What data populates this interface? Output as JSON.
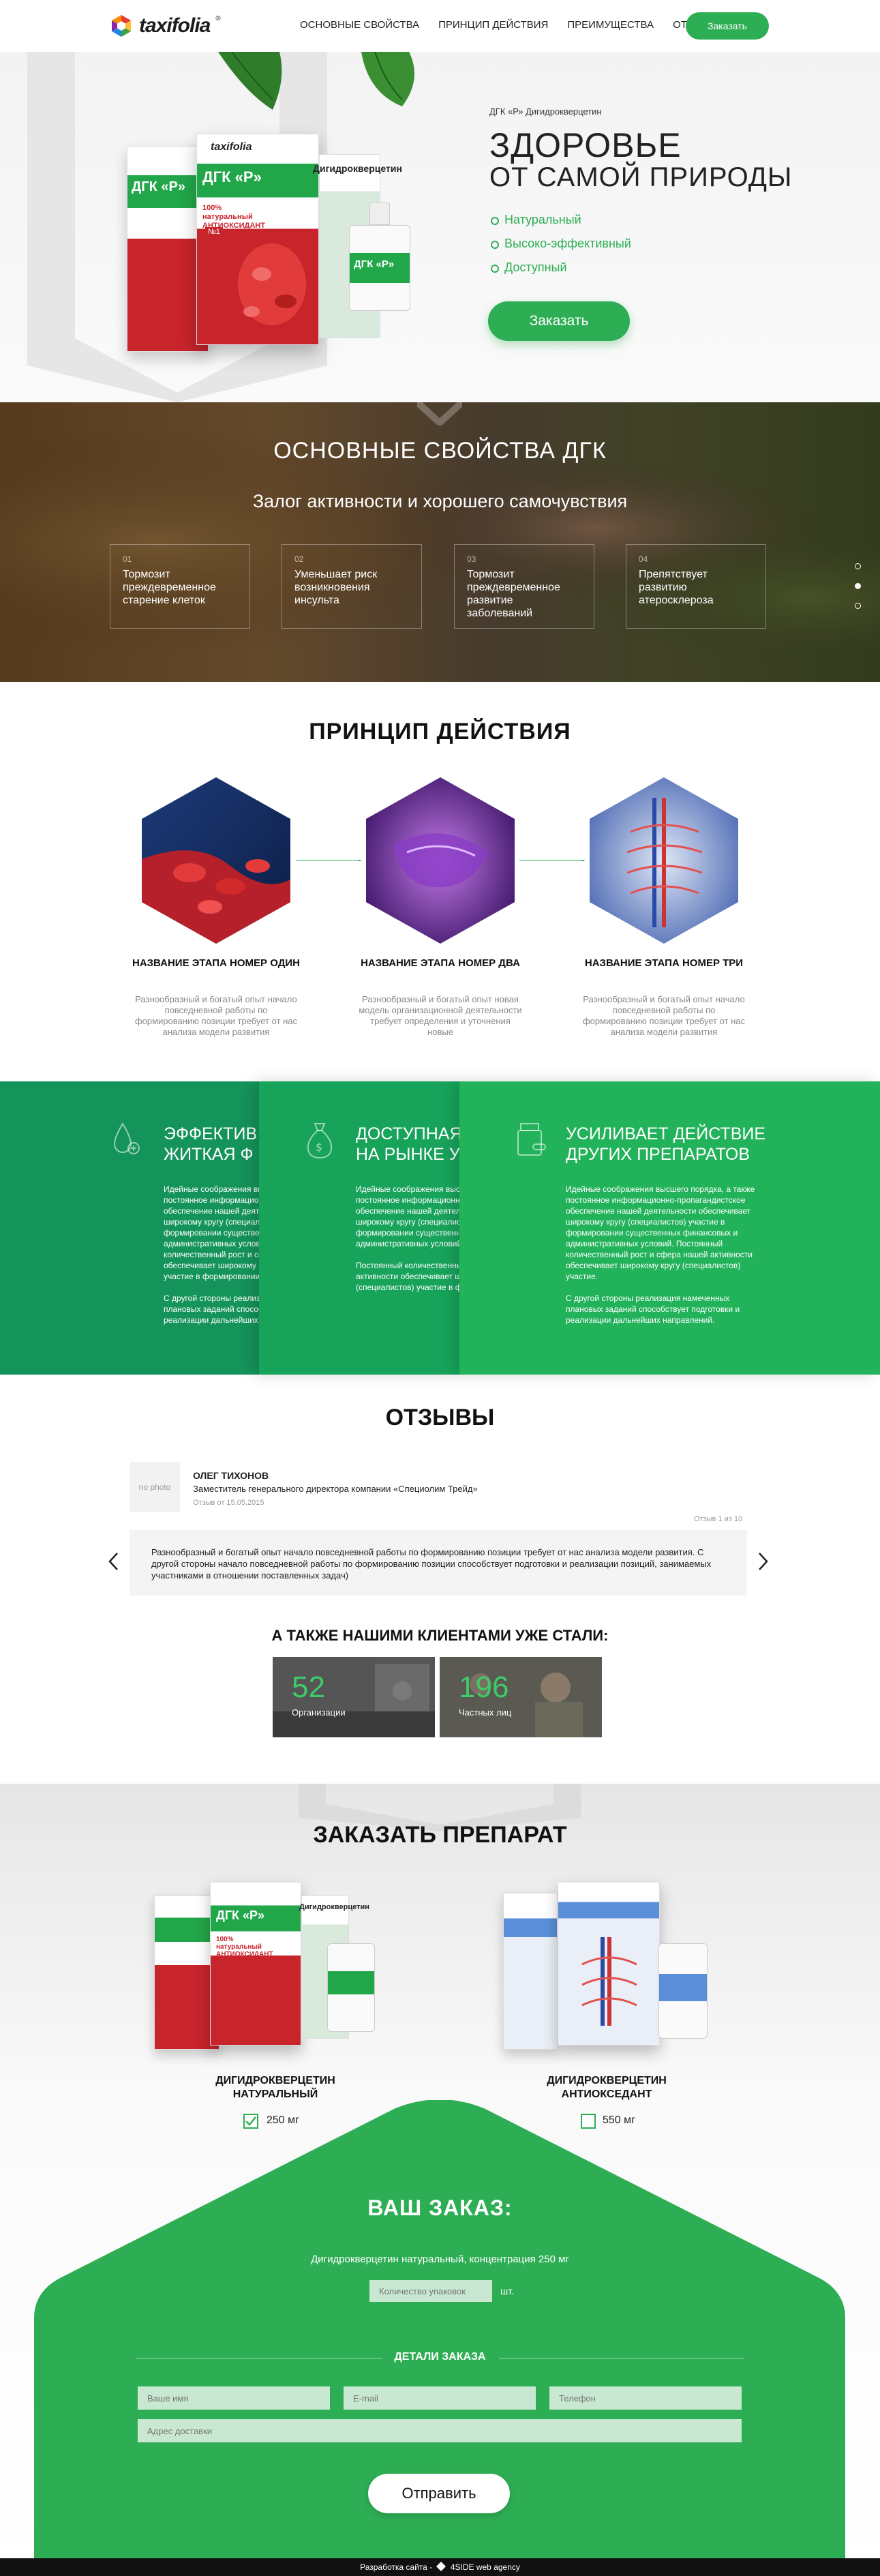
{
  "brand": {
    "name": "taxifolia",
    "reg": "®",
    "accent": "#2eae54"
  },
  "nav": {
    "items": [
      {
        "label": "ОСНОВНЫЕ СВОЙСТВА"
      },
      {
        "label": "ПРИНЦИП ДЕЙСТВИЯ"
      },
      {
        "label": "ПРЕИМУЩЕСТВА"
      },
      {
        "label": "ОТЗЫВЫ"
      }
    ],
    "order_button": "Заказать"
  },
  "hero": {
    "subtitle": "ДГК «Р» Дигидрокверцетин",
    "title_line1": "ЗДОРОВЬЕ",
    "title_line2": "ОТ САМОЙ ПРИРОДЫ",
    "features": [
      "Натуральный",
      "Высоко-эффективный",
      "Доступный"
    ],
    "cta": "Заказать",
    "package_label": "ДГК «Р»",
    "package_name": "Дигидрокверцетин",
    "package_badge": "100% натуральный АНТИОКСИДАНТ",
    "package_no": "№1"
  },
  "properties": {
    "title": "ОСНОВНЫЕ СВОЙСТВА ДГК",
    "subtitle": "Залог активности и хорошего самочувствия",
    "cards": [
      {
        "num": "01",
        "text": "Тормозит преждевременное старение клеток"
      },
      {
        "num": "02",
        "text": "Уменьшает риск возникновения инсульта"
      },
      {
        "num": "03",
        "text": "Тормозит преждевременное развитие заболеваний"
      },
      {
        "num": "04",
        "text": "Препятствует развитию атеросклероза"
      }
    ]
  },
  "principle": {
    "title": "ПРИНЦИП ДЕЙСТВИЯ",
    "stages": [
      {
        "name": "НАЗВАНИЕ ЭТАПА НОМЕР ОДИН",
        "desc": "Разнообразный и богатый опыт начало повседневной работы по формированию позиции требует от нас анализа модели развития"
      },
      {
        "name": "НАЗВАНИЕ ЭТАПА НОМЕР ДВА",
        "desc": "Разнообразный и богатый опыт новая модель организационной деятельности требует определения и уточнения новые"
      },
      {
        "name": "НАЗВАНИЕ ЭТАПА НОМЕР ТРИ",
        "desc": "Разнообразный и богатый опыт начало повседневной работы по формированию позиции требует от нас анализа модели развития"
      }
    ]
  },
  "advantages": [
    {
      "title_line1": "ЭФФЕКТИВ",
      "title_line2": "ЖИТКАЯ Ф",
      "body": "Идейные соображения высшего порядка, а также постоянное информационно-пропагандистское обеспечение нашей деятельности обеспечивает широкому кругу (специалистов) участие в формировании существенных финансовых и административных условий. Постоянный количественный рост и сфера нашей активности обеспечивает широкому кругу (специалистов) участие в формировании.",
      "body2": "С другой стороны реализация намеченных плановых заданий способствует подготовки и реализации дальнейших направлений."
    },
    {
      "title_line1": "ДОСТУПНАЯ",
      "title_line2": "НА РЫНКЕ У",
      "body": "Идейные соображения высшего порядка, а также постоянное информационно-пропагандистское обеспечение нашей деятельности обеспечивает широкому кругу (специалистов) участие в формировании существенных финансовых и административных условий.",
      "body2": "Постоянный количественный рост и сфера нашей активности обеспечивает широкому кругу (специалистов) участие в формировании."
    },
    {
      "title_line1": "УСИЛИВАЕТ ДЕЙСТВИЕ",
      "title_line2": "ДРУГИХ ПРЕПАРАТОВ",
      "body": "Идейные соображения высшего порядка, а также постоянное информационно-пропагандистское обеспечение нашей деятельности обеспечивает широкому кругу (специалистов) участие в формировании существенных финансовых и административных условий. Постоянный количественный рост и сфера нашей активности обеспечивает широкому кругу (специалистов) участие.",
      "body2": "С другой стороны реализация намеченных плановых заданий способствует подготовки и реализации дальнейших направлений."
    }
  ],
  "reviews": {
    "title": "ОТЗЫВЫ",
    "photo_placeholder": "no photo",
    "name": "ОЛЕГ ТИХОНОВ",
    "role": "Заместитель генерального директора компании «Специолим Трейд»",
    "date": "Отзыв от 15.05.2015",
    "counter": "Отзыв 1 из 10",
    "text": "Разнообразный и богатый опыт начало повседневной работы по формированию позиции требует от нас анализа модели развития. С другой стороны начало повседневной работы по формированию позиции способствует подготовки и реализации позиций, занимаемых участниками в отношении поставленных задач)",
    "prev_icon": "chevron-left",
    "next_icon": "chevron-right"
  },
  "clients": {
    "title": "А ТАКЖЕ НАШИМИ КЛИЕНТАМИ УЖЕ СТАЛИ:",
    "stats": [
      {
        "num": "52",
        "label": "Организации"
      },
      {
        "num": "196",
        "label": "Частных лиц"
      }
    ]
  },
  "order": {
    "title": "ЗАКАЗАТЬ ПРЕПАРАТ",
    "products": [
      {
        "name_line1": "ДИГИДРОКВЕРЦЕТИН",
        "name_line2": "НАТУРАЛЬНЫЙ",
        "dose": "250 мг",
        "checked": true
      },
      {
        "name_line1": "ДИГИДРОКВЕРЦЕТИН",
        "name_line2": "АНТИОКСЕДАНТ",
        "dose": "550 мг",
        "checked": false
      }
    ],
    "your_order": "ВАШ ЗАКАЗ:",
    "summary": "Дигидрокверцетин натуральный, концентрация 250 мг",
    "qty_placeholder": "Количество упаковок",
    "qty_unit": "шт.",
    "details_title": "ДЕТАЛИ ЗАКАЗА",
    "fields": {
      "name": "Ваше имя",
      "email": "E-mail",
      "phone": "Телефон",
      "address": "Адрес доставки"
    },
    "submit": "Отправить"
  },
  "footer": {
    "text": "Разработка сайта -",
    "agency": "4SIDE web agency"
  }
}
